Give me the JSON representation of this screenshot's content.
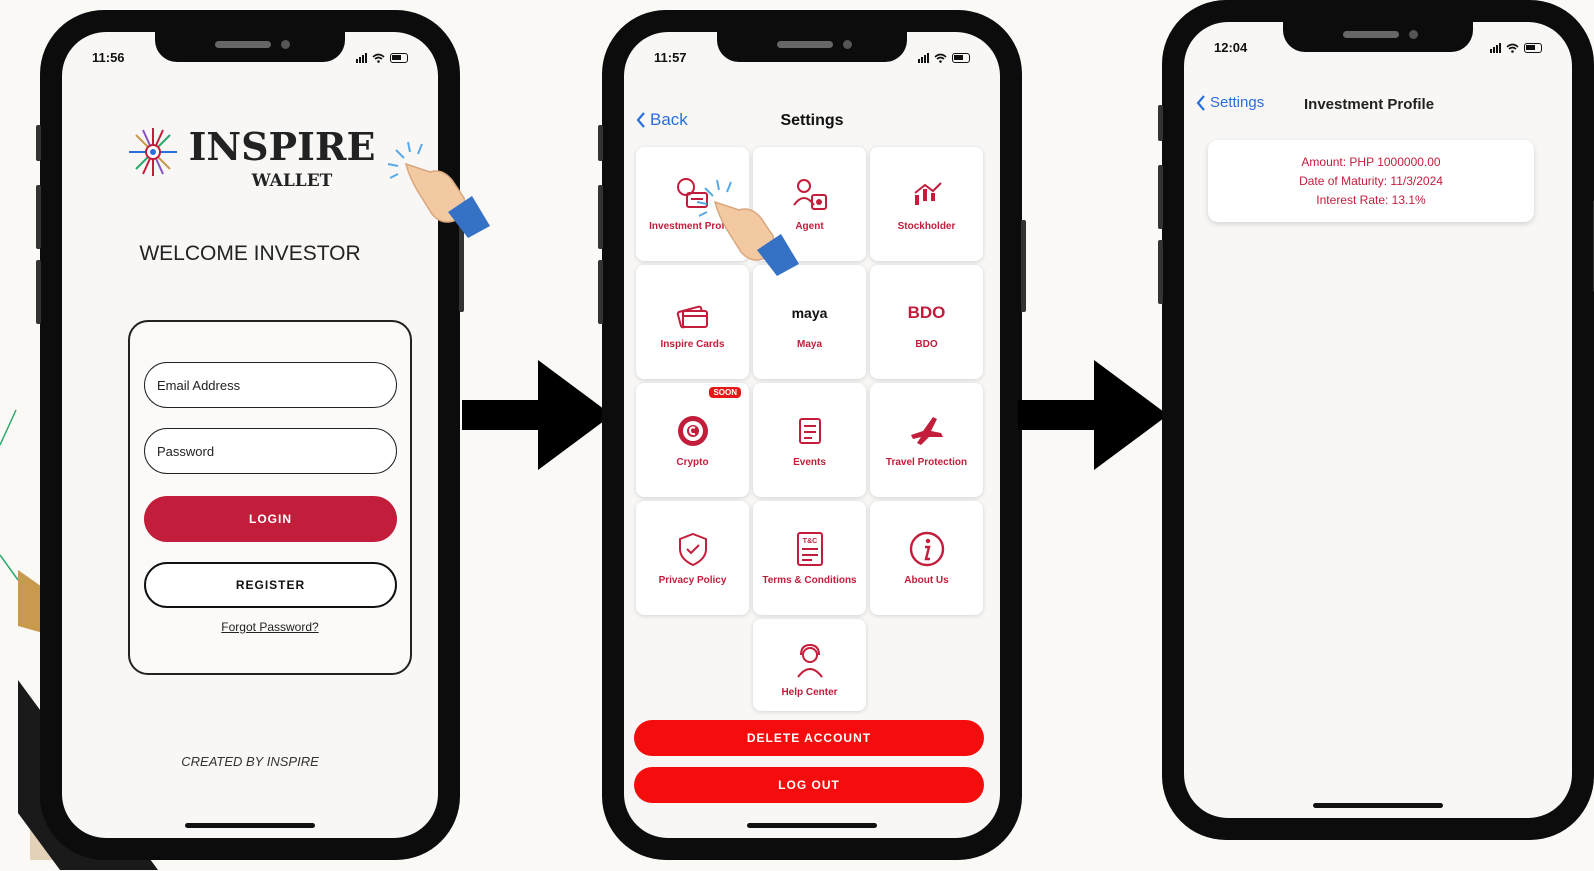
{
  "colors": {
    "accent_red": "#c21d3b",
    "bright_red": "#f50d0d",
    "link_blue": "#2a6edb"
  },
  "login_screen": {
    "time": "11:56",
    "brand": "INSPIRE",
    "brand_sub": "WALLET",
    "welcome": "WELCOME INVESTOR",
    "email_placeholder": "Email Address",
    "password_placeholder": "Password",
    "login_label": "LOGIN",
    "register_label": "REGISTER",
    "forgot_label": "Forgot Password?",
    "credit": "CREATED BY INSPIRE"
  },
  "settings_screen": {
    "time": "11:57",
    "back_label": "Back",
    "title": "Settings",
    "tiles": [
      {
        "label": "Investment Profile",
        "icon": "investment-icon"
      },
      {
        "label": "Agent",
        "icon": "agent-icon"
      },
      {
        "label": "Stockholder",
        "icon": "stockholder-icon"
      },
      {
        "label": "Inspire Cards",
        "icon": "cards-icon"
      },
      {
        "label": "Maya",
        "icon": "maya-logo",
        "logo_text": "maya"
      },
      {
        "label": "BDO",
        "icon": "bdo-logo",
        "logo_text": "BDO"
      },
      {
        "label": "Crypto",
        "icon": "crypto-icon",
        "badge": "SOON"
      },
      {
        "label": "Events",
        "icon": "events-icon"
      },
      {
        "label": "Travel Protection",
        "icon": "airplane-icon"
      },
      {
        "label": "Privacy Policy",
        "icon": "shield-icon"
      },
      {
        "label": "Terms & Conditions",
        "icon": "terms-icon",
        "icon_text": "T&C"
      },
      {
        "label": "About Us",
        "icon": "info-icon"
      },
      {
        "label": "Help Center",
        "icon": "support-icon"
      }
    ],
    "delete_label": "DELETE ACCOUNT",
    "logout_label": "LOG OUT"
  },
  "profile_screen": {
    "time": "12:04",
    "back_label": "Settings",
    "title": "Investment Profile",
    "amount": "Amount: PHP 1000000.00",
    "maturity": "Date of Maturity: 11/3/2024",
    "rate": "Interest Rate: 13.1%"
  }
}
